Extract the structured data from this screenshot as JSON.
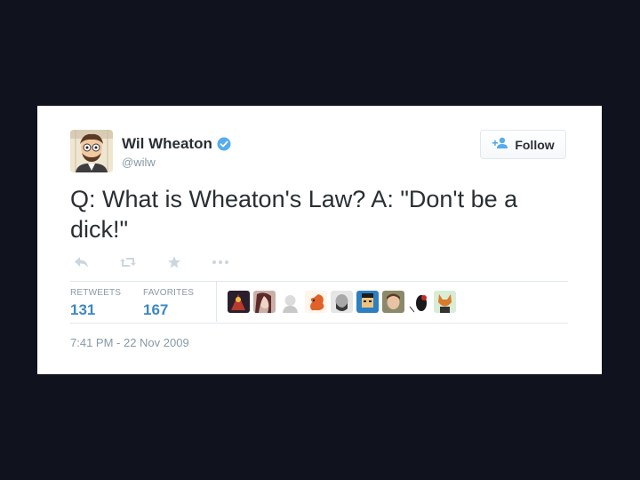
{
  "tweet": {
    "author_name": "Wil Wheaton",
    "handle": "@wilw",
    "text": "Q: What is Wheaton's Law? A: \"Don't be a dick!\"",
    "timestamp": "7:41 PM - 22 Nov 2009"
  },
  "follow_button": {
    "label": "Follow"
  },
  "actions": [
    "reply-icon",
    "retweet-icon",
    "favorite-icon",
    "more-icon"
  ],
  "stats": {
    "retweets_label": "RETWEETS",
    "retweets_value": "131",
    "favorites_label": "FAVORITES",
    "favorites_value": "167"
  },
  "colors": {
    "background": "#10131e",
    "card": "#ffffff",
    "accent": "#3b88c3",
    "verified": "#55acee",
    "text": "#292f33",
    "muted": "#8899a6"
  },
  "faces": [
    "face-1",
    "face-2",
    "face-3",
    "face-4",
    "face-5",
    "face-6",
    "face-7",
    "face-8",
    "face-9"
  ]
}
